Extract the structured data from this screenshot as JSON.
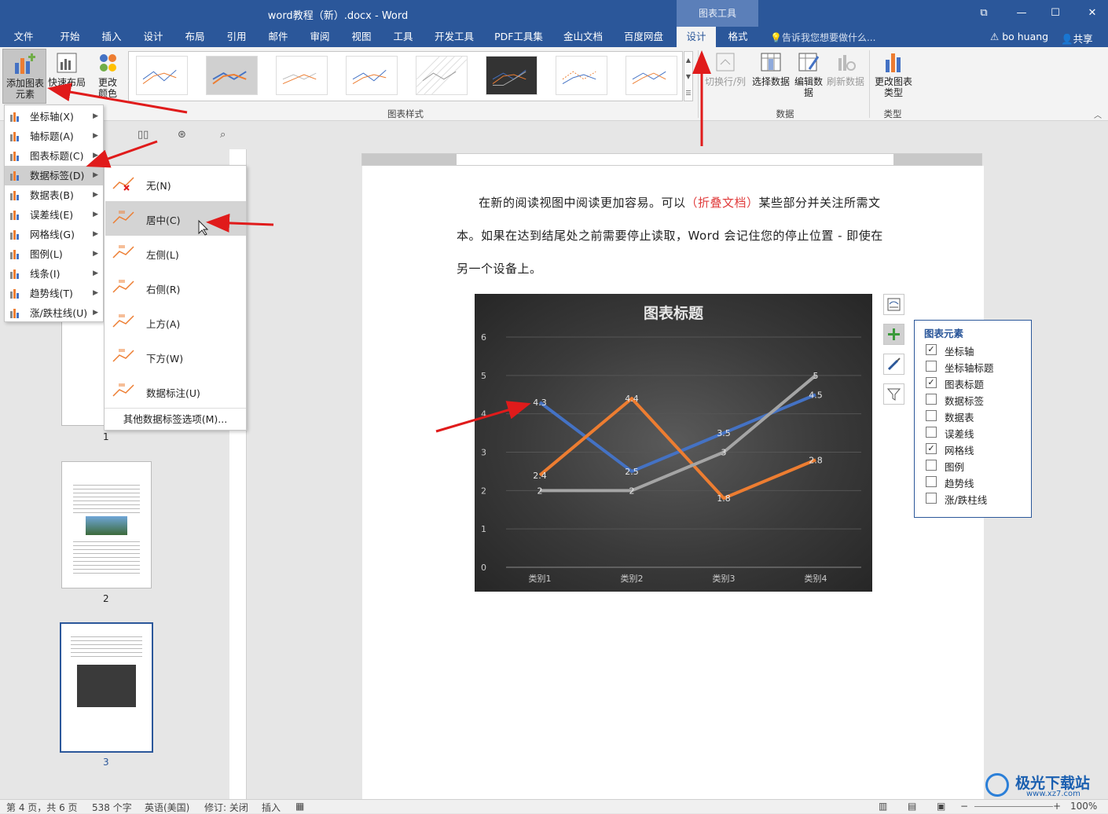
{
  "window": {
    "title": "word教程（新）.docx - Word",
    "context_tab": "图表工具",
    "user": "bo huang",
    "share": "共享",
    "search_placeholder": "告诉我您想要做什么..."
  },
  "tabs": [
    "文件",
    "开始",
    "插入",
    "设计",
    "布局",
    "引用",
    "邮件",
    "审阅",
    "视图",
    "工具",
    "开发工具",
    "PDF工具集",
    "金山文档",
    "百度网盘",
    "设计",
    "格式"
  ],
  "ribbon": {
    "add_element": "添加图表元素",
    "quick_layout": "快速布局",
    "change_color": "更改颜色",
    "switch_rowcol": "切换行/列",
    "select_data": "选择数据",
    "edit_data": "编辑数据",
    "refresh_data": "刷新数据",
    "change_type": "更改图表类型",
    "group_styles": "图表样式",
    "group_data": "数据",
    "group_type": "类型"
  },
  "menu1": [
    "坐标轴(X)",
    "轴标题(A)",
    "图表标题(C)",
    "数据标签(D)",
    "数据表(B)",
    "误差线(E)",
    "网格线(G)",
    "图例(L)",
    "线条(I)",
    "趋势线(T)",
    "涨/跌柱线(U)"
  ],
  "menu2": [
    "无(N)",
    "居中(C)",
    "左侧(L)",
    "右侧(R)",
    "上方(A)",
    "下方(W)",
    "数据标注(U)"
  ],
  "menu2_more": "其他数据标签选项(M)...",
  "document": {
    "line1_a": "在新的阅读视图中阅读更加容易。可以",
    "line1_red": "（折叠文档）",
    "line1_b": "某些部分并关注所需文",
    "line2": "本。如果在达到结尾处之前需要停止读取，Word 会记住您的停止位置 - 即使在",
    "line3": "另一个设备上。"
  },
  "thumbs": [
    "1",
    "2",
    "3"
  ],
  "chart_data": {
    "type": "line",
    "title": "图表标题",
    "categories": [
      "类别1",
      "类别2",
      "类别3",
      "类别4"
    ],
    "series": [
      {
        "values": [
          4.3,
          2.5,
          3.5,
          4.5
        ],
        "color": "#4472c4"
      },
      {
        "values": [
          2.4,
          4.4,
          1.8,
          2.8
        ],
        "color": "#ed7d31"
      },
      {
        "values": [
          2,
          2,
          3,
          5
        ],
        "color": "#a5a5a5"
      }
    ],
    "y_ticks": [
      "0",
      "1",
      "2",
      "3",
      "4",
      "5",
      "6"
    ],
    "ylim": [
      0,
      6
    ],
    "grid": true
  },
  "elements_panel": {
    "title": "图表元素",
    "items": [
      {
        "label": "坐标轴",
        "checked": true
      },
      {
        "label": "坐标轴标题",
        "checked": false
      },
      {
        "label": "图表标题",
        "checked": true
      },
      {
        "label": "数据标签",
        "checked": false
      },
      {
        "label": "数据表",
        "checked": false
      },
      {
        "label": "误差线",
        "checked": false
      },
      {
        "label": "网格线",
        "checked": true
      },
      {
        "label": "图例",
        "checked": false
      },
      {
        "label": "趋势线",
        "checked": false
      },
      {
        "label": "涨/跌柱线",
        "checked": false
      }
    ]
  },
  "status": {
    "page": "第 4 页，共 6 页",
    "words": "538 个字",
    "lang": "英语(美国)",
    "track": "修订: 关闭",
    "mode": "插入",
    "zoom": "100%"
  },
  "watermark": {
    "name": "极光下载站",
    "url": "www.xz7.com"
  }
}
